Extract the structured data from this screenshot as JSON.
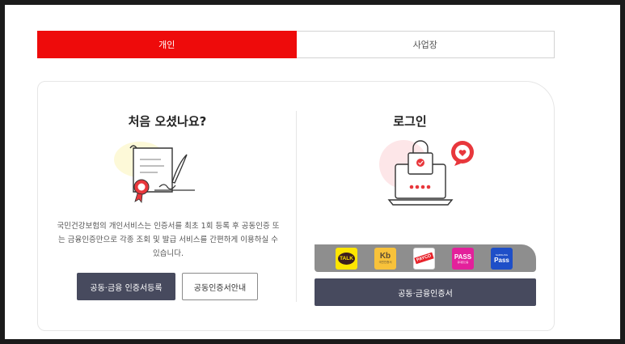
{
  "tabs": [
    {
      "label": "개인",
      "active": true
    },
    {
      "label": "사업장",
      "active": false
    }
  ],
  "first_visit": {
    "title": "처음 오셨나요?",
    "description": "국민건강보험의 개인서비스는 인증서를 최초 1회 등록 후 공동인증 또는 금융인증만으로 각종 조회 및 발급 서비스를 간편하게 이용하실 수 있습니다.",
    "register_button": "공동·금융 인증서등록",
    "guide_button": "공동인증서안내"
  },
  "login": {
    "title": "로그인",
    "auth_methods": [
      {
        "name": "kakao",
        "label": "TALK",
        "icon": "kakao-talk-icon"
      },
      {
        "name": "kb",
        "label": "Kb",
        "sub": "국민인증서",
        "icon": "kb-icon"
      },
      {
        "name": "payco",
        "label": "PAYCO",
        "icon": "payco-icon"
      },
      {
        "name": "pass",
        "label": "PASS",
        "sub": "휴대폰인증",
        "icon": "pass-icon"
      },
      {
        "name": "samsung-pass",
        "label": "Pass",
        "sub": "SAMSUNG",
        "icon": "samsung-pass-icon"
      }
    ],
    "login_button": "공동·금융인증서"
  },
  "colors": {
    "accent": "#ee0b0b",
    "button_dark": "#474a5e",
    "auth_bar": "#8e8e8e"
  }
}
